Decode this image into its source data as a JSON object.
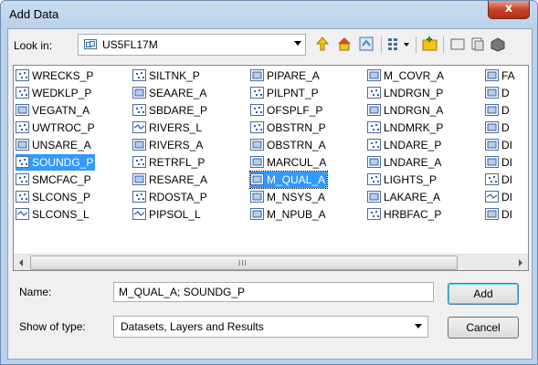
{
  "window": {
    "title": "Add Data",
    "close_glyph": "x"
  },
  "lookin": {
    "label": "Look in:",
    "value": "US5FL17M"
  },
  "columns": [
    [
      {
        "label": "WRECKS_P",
        "icon": "point"
      },
      {
        "label": "WEDKLP_P",
        "icon": "point"
      },
      {
        "label": "VEGATN_A",
        "icon": "poly"
      },
      {
        "label": "UWTROC_P",
        "icon": "point"
      },
      {
        "label": "UNSARE_A",
        "icon": "poly"
      },
      {
        "label": "SOUNDG_P",
        "icon": "point",
        "state": "selected"
      },
      {
        "label": "SMCFAC_P",
        "icon": "point"
      },
      {
        "label": "SLCONS_P",
        "icon": "point"
      },
      {
        "label": "SLCONS_L",
        "icon": "line"
      }
    ],
    [
      {
        "label": "SILTNK_P",
        "icon": "point"
      },
      {
        "label": "SEAARE_A",
        "icon": "poly"
      },
      {
        "label": "SBDARE_P",
        "icon": "point"
      },
      {
        "label": "RIVERS_L",
        "icon": "line"
      },
      {
        "label": "RIVERS_A",
        "icon": "poly"
      },
      {
        "label": "RETRFL_P",
        "icon": "point"
      },
      {
        "label": "RESARE_A",
        "icon": "poly"
      },
      {
        "label": "RDOSTA_P",
        "icon": "point"
      },
      {
        "label": "PIPSOL_L",
        "icon": "line"
      }
    ],
    [
      {
        "label": "PIPARE_A",
        "icon": "poly"
      },
      {
        "label": "PILPNT_P",
        "icon": "point"
      },
      {
        "label": "OFSPLF_P",
        "icon": "point"
      },
      {
        "label": "OBSTRN_P",
        "icon": "point"
      },
      {
        "label": "OBSTRN_A",
        "icon": "poly"
      },
      {
        "label": "MARCUL_A",
        "icon": "poly"
      },
      {
        "label": "M_QUAL_A",
        "icon": "poly",
        "state": "focus"
      },
      {
        "label": "M_NSYS_A",
        "icon": "poly"
      },
      {
        "label": "M_NPUB_A",
        "icon": "poly"
      }
    ],
    [
      {
        "label": "M_COVR_A",
        "icon": "poly"
      },
      {
        "label": "LNDRGN_P",
        "icon": "point"
      },
      {
        "label": "LNDRGN_A",
        "icon": "poly"
      },
      {
        "label": "LNDMRK_P",
        "icon": "point"
      },
      {
        "label": "LNDARE_P",
        "icon": "point"
      },
      {
        "label": "LNDARE_A",
        "icon": "poly"
      },
      {
        "label": "LIGHTS_P",
        "icon": "point"
      },
      {
        "label": "LAKARE_A",
        "icon": "poly"
      },
      {
        "label": "HRBFAC_P",
        "icon": "point"
      }
    ],
    [
      {
        "label": "FA",
        "icon": "poly"
      },
      {
        "label": "D",
        "icon": "poly"
      },
      {
        "label": "D",
        "icon": "poly"
      },
      {
        "label": "D",
        "icon": "poly"
      },
      {
        "label": "DI",
        "icon": "poly"
      },
      {
        "label": "DI",
        "icon": "poly"
      },
      {
        "label": "DI",
        "icon": "point"
      },
      {
        "label": "DI",
        "icon": "line"
      },
      {
        "label": "DI",
        "icon": "poly"
      }
    ]
  ],
  "scrollbar": {
    "grip": "III"
  },
  "name": {
    "label": "Name:",
    "value": "M_QUAL_A; SOUNDG_P"
  },
  "type": {
    "label": "Show of type:",
    "value": "Datasets, Layers and Results"
  },
  "buttons": {
    "add": "Add",
    "cancel": "Cancel"
  },
  "colors": {
    "selection": "#3399ff",
    "point_icon": "#3a8bd6"
  }
}
